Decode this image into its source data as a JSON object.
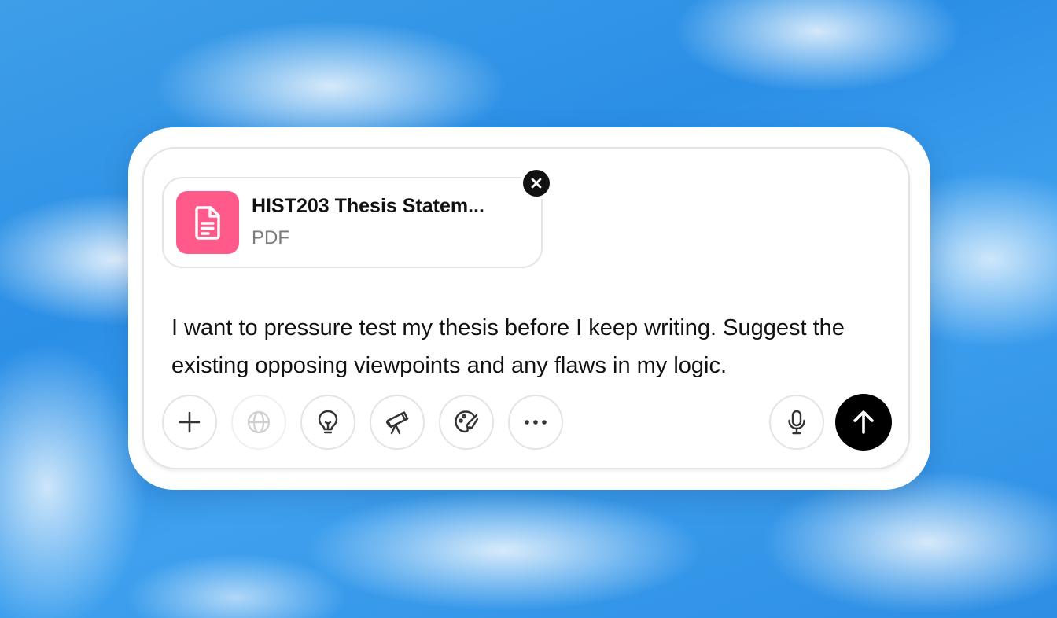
{
  "attachment": {
    "file_name": "HIST203 Thesis Statem...",
    "file_type": "PDF",
    "icon": "document-icon",
    "icon_color": "#ff5a8a"
  },
  "composer": {
    "prompt_text": "I want to pressure test my thesis before I keep writing. Suggest the existing opposing viewpoints and any flaws in my logic."
  },
  "toolbar": {
    "left_icons": [
      "plus-icon",
      "globe-icon",
      "lightbulb-icon",
      "telescope-icon",
      "paintbrush-icon",
      "more-icon"
    ],
    "right_icons": [
      "microphone-icon",
      "arrow-up-icon"
    ]
  },
  "colors": {
    "send_button": "#000000",
    "remove_button": "#111111",
    "background": "#2b8fe6"
  }
}
